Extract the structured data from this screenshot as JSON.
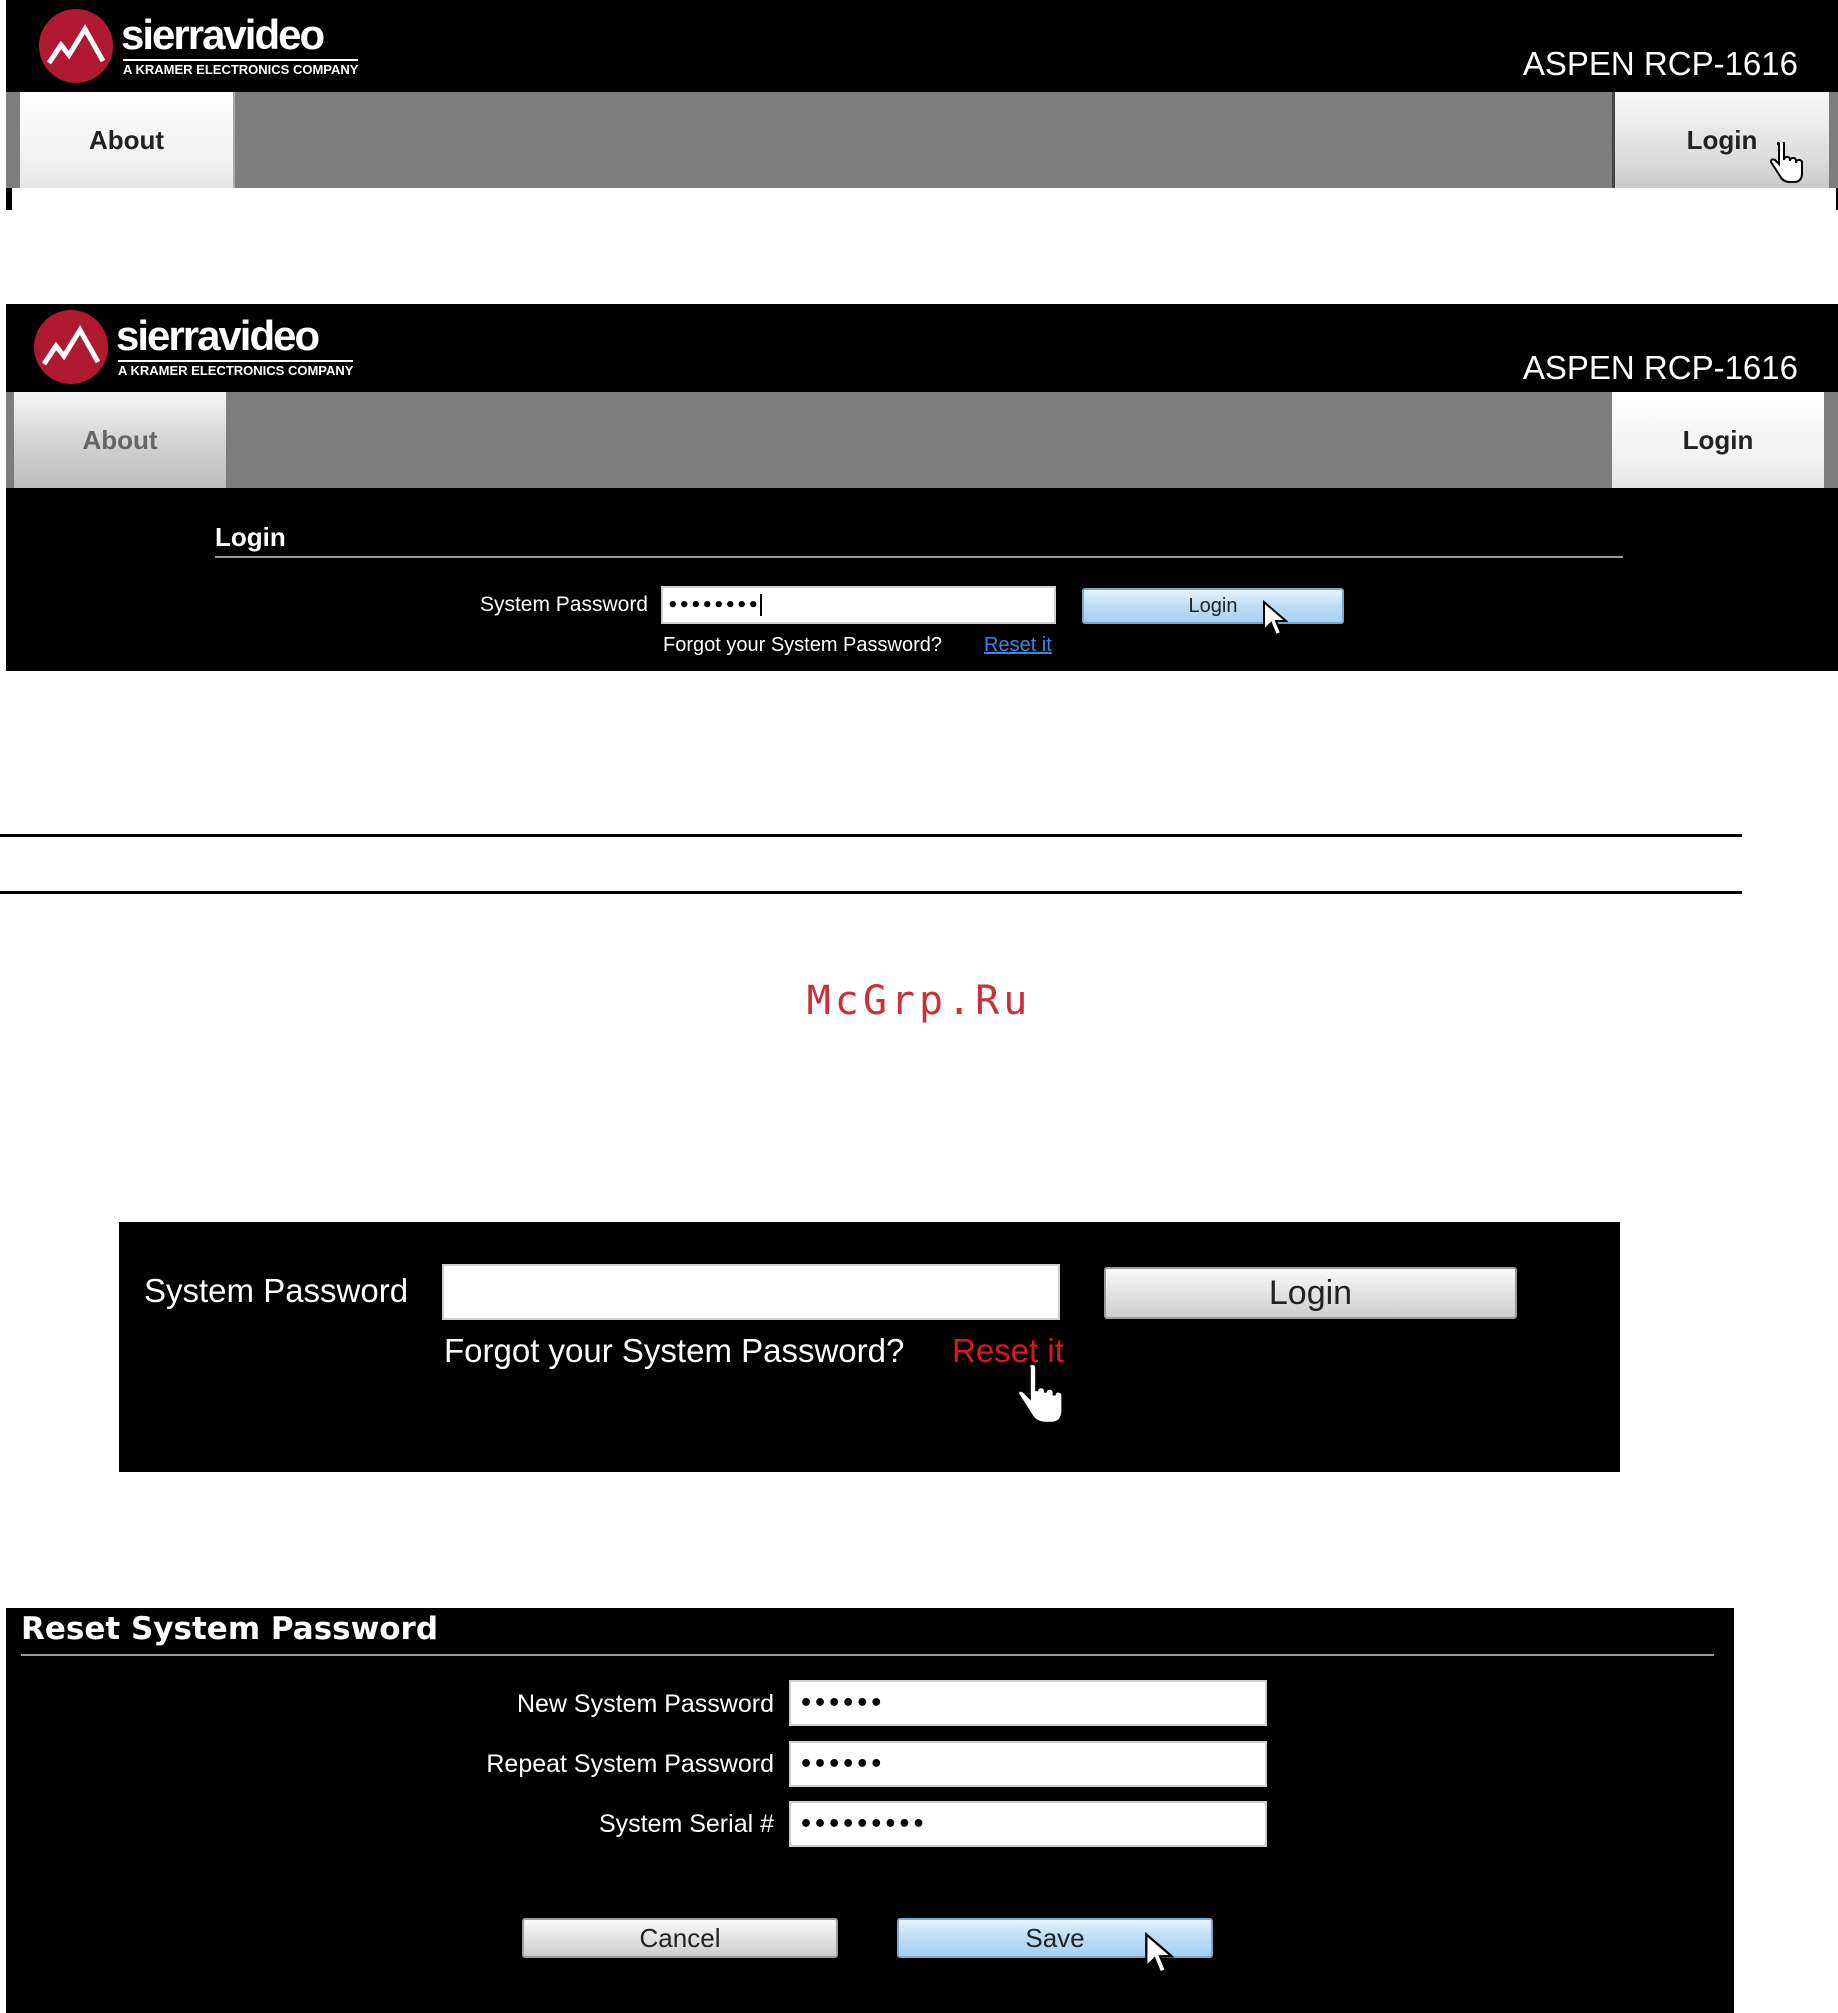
{
  "brand": {
    "name": "sierravideo",
    "tagline": "A KRAMER ELECTRONICS COMPANY",
    "color": "#b01a30"
  },
  "device_model": "ASPEN RCP-1616",
  "nav": {
    "about": "About",
    "login": "Login"
  },
  "login_panel": {
    "title": "Login",
    "password_label": "System Password",
    "password_value": "••••••••",
    "button": "Login",
    "forgot_text": "Forgot your System Password?",
    "reset_link": "Reset it"
  },
  "watermark": "McGrp.Ru",
  "reset_zoom": {
    "password_label": "System Password",
    "password_value": "",
    "button": "Login",
    "forgot_text": "Forgot your System Password?",
    "reset_link": "Reset it",
    "reset_link_color": "#e0141e"
  },
  "reset_panel": {
    "title": "Reset System Password",
    "new_label": "New System Password",
    "new_value": "••••••",
    "repeat_label": "Repeat System Password",
    "repeat_value": "••••••",
    "serial_label": "System Serial #",
    "serial_value": "•••••••••",
    "cancel": "Cancel",
    "save": "Save"
  }
}
